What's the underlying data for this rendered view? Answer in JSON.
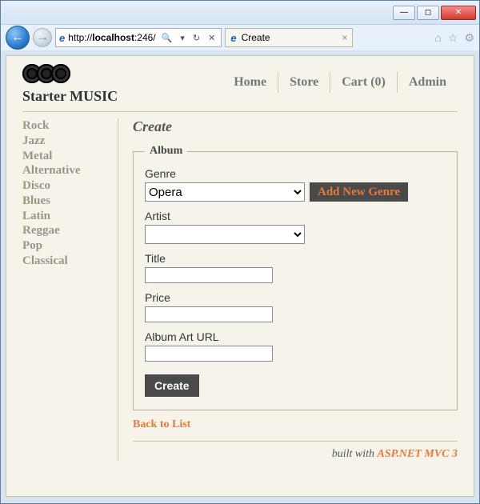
{
  "window": {
    "url_prefix": "http://",
    "url_host": "localhost",
    "url_port": ":246/",
    "tab_title": "Create"
  },
  "brand": {
    "title": "Starter MUSIC"
  },
  "nav": {
    "home": "Home",
    "store": "Store",
    "cart": "Cart (0)",
    "admin": "Admin"
  },
  "sidebar": {
    "items": [
      "Rock",
      "Jazz",
      "Metal",
      "Alternative",
      "Disco",
      "Blues",
      "Latin",
      "Reggae",
      "Pop",
      "Classical"
    ]
  },
  "page": {
    "heading": "Create",
    "legend": "Album",
    "genre_label": "Genre",
    "genre_selected": "Opera",
    "add_genre_label": "Add New Genre",
    "artist_label": "Artist",
    "artist_selected": "",
    "title_label": "Title",
    "title_value": "",
    "price_label": "Price",
    "price_value": "",
    "arturl_label": "Album Art URL",
    "arturl_value": "",
    "create_label": "Create",
    "back_label": "Back to List"
  },
  "footer": {
    "prefix": "built with ",
    "link": "ASP.NET MVC 3"
  },
  "icons": {
    "search": "🔍",
    "refresh": "↻",
    "stop": "✕",
    "home": "⌂",
    "star": "☆",
    "gear": "⚙"
  }
}
